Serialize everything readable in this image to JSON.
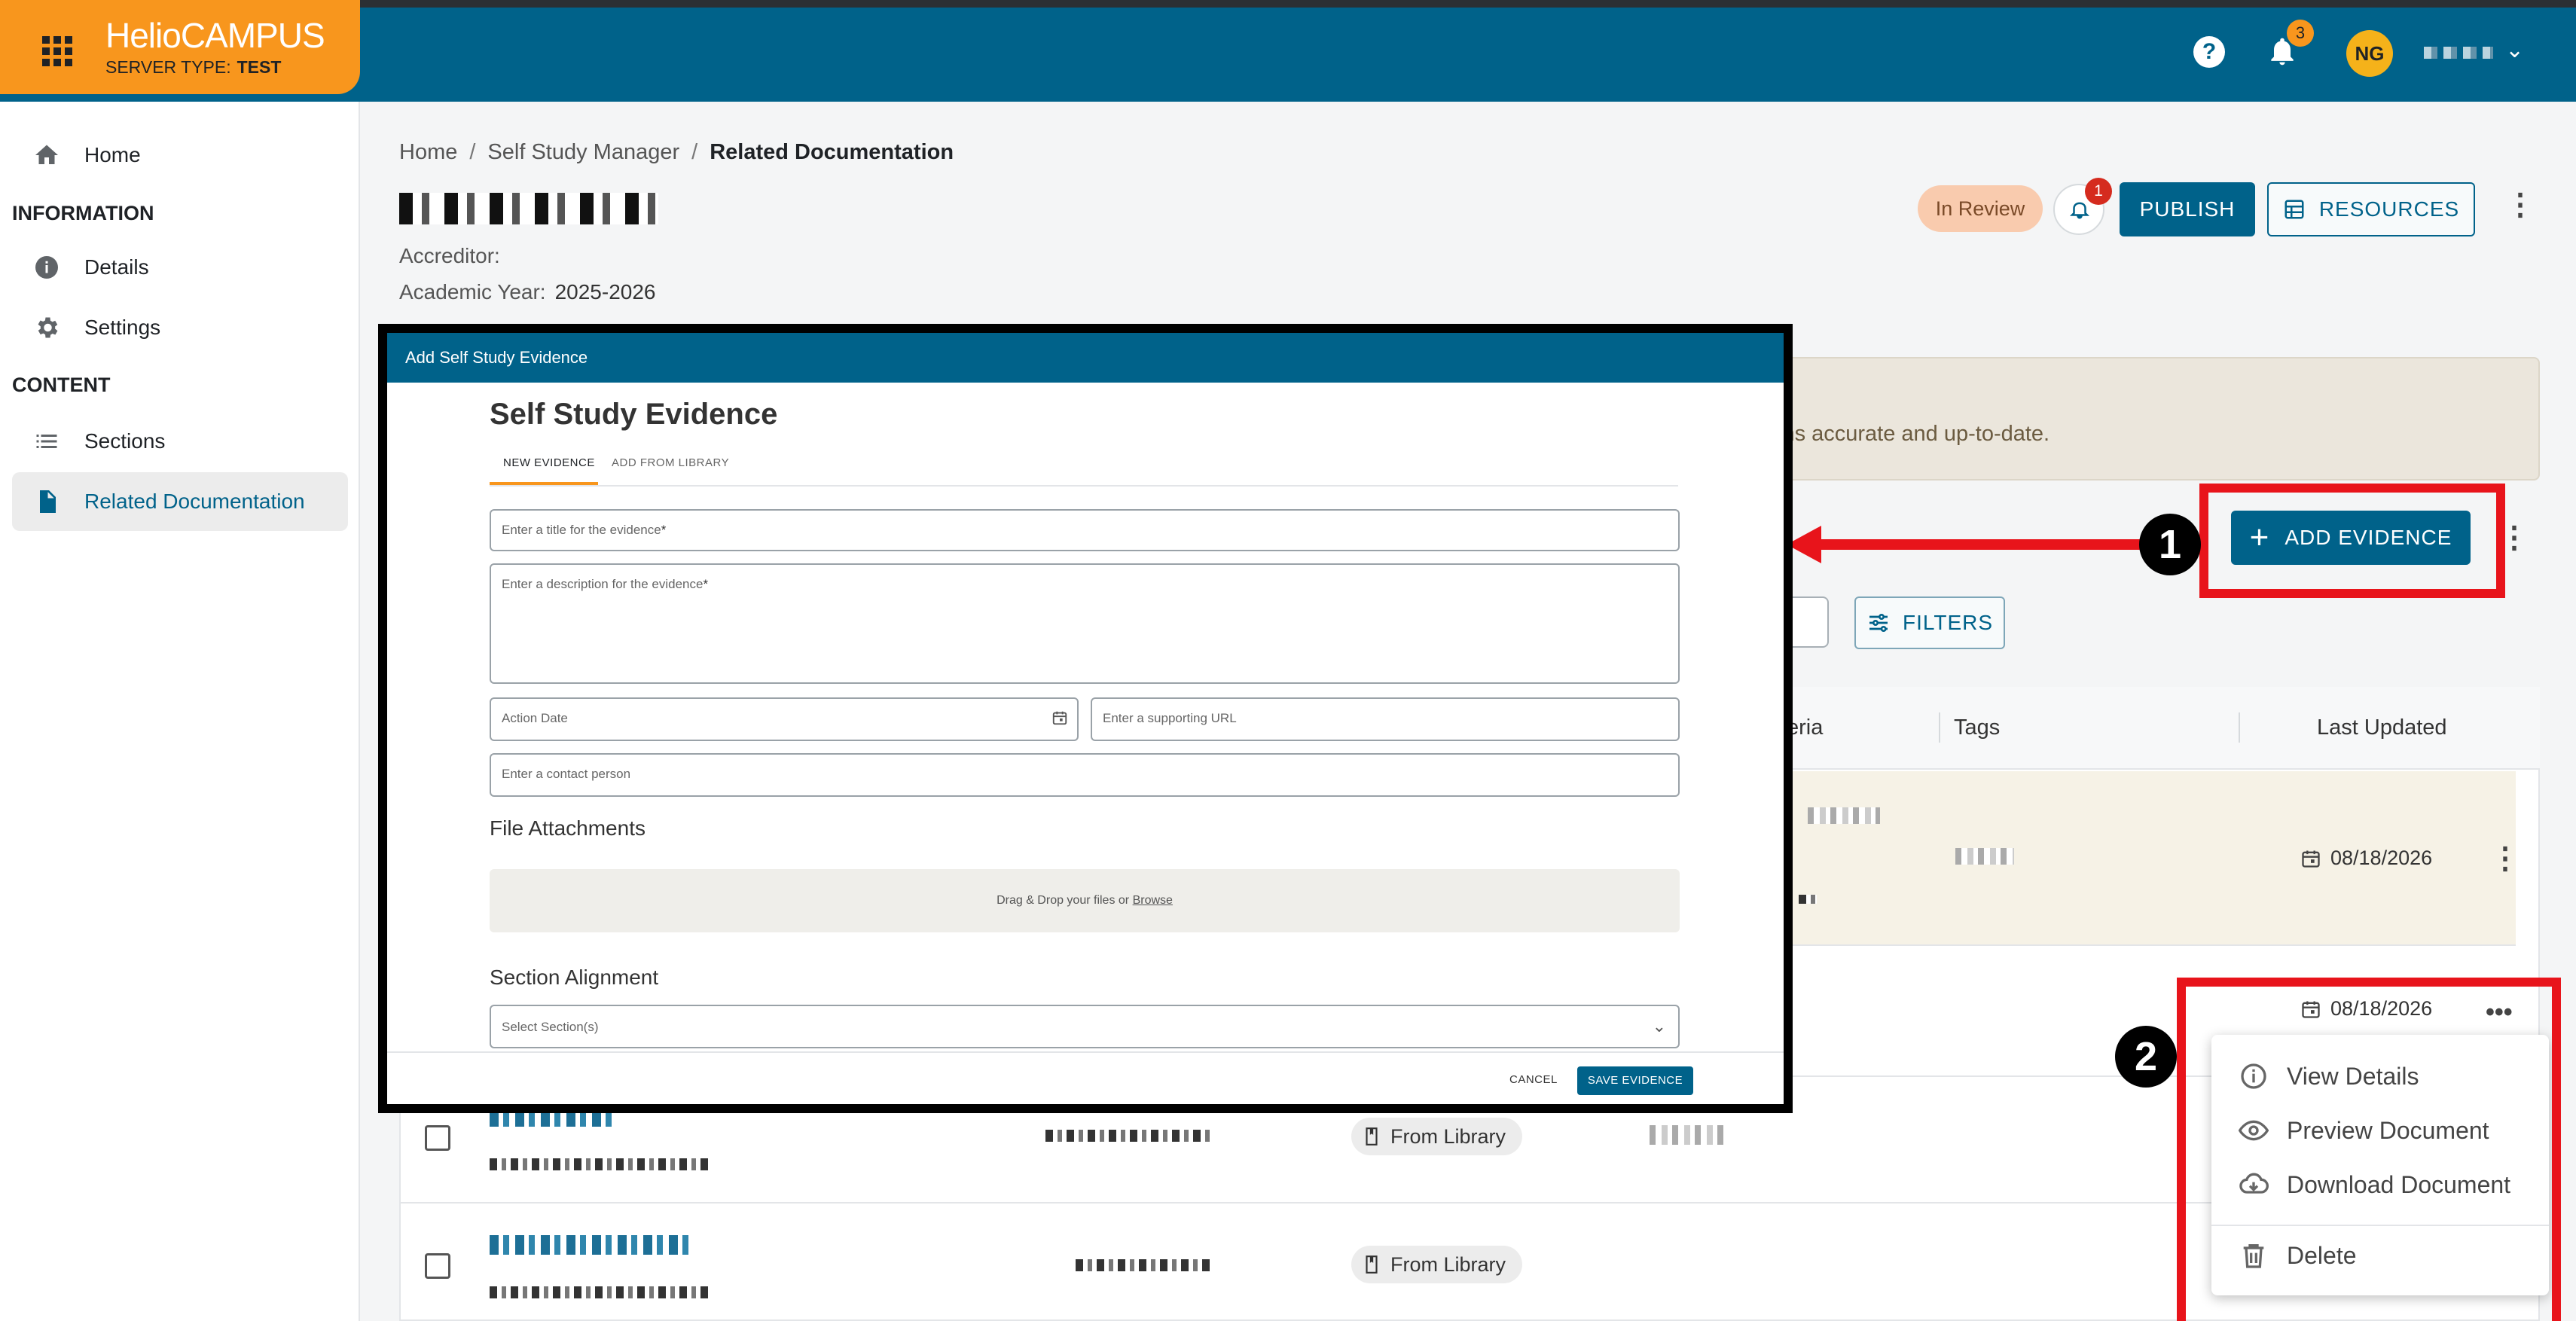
{
  "app": {
    "logo_part1": "Helio",
    "logo_part2": "CAMPUS",
    "server_label": "SERVER TYPE:",
    "server_value": "TEST",
    "notification_count": "3",
    "avatar_initials": "NG"
  },
  "sidebar": {
    "home": "Home",
    "information_heading": "INFORMATION",
    "details": "Details",
    "settings": "Settings",
    "content_heading": "CONTENT",
    "sections": "Sections",
    "related_documentation": "Related Documentation"
  },
  "breadcrumb": {
    "home": "Home",
    "self_study_manager": "Self Study Manager",
    "current": "Related Documentation",
    "separator": "/"
  },
  "header": {
    "accreditor_label": "Accreditor:",
    "academic_year_label": "Academic Year:",
    "academic_year_value": "2025-2026",
    "status": "In Review",
    "bell_count": "1",
    "publish": "PUBLISH",
    "resources": "RESOURCES"
  },
  "main": {
    "banner_text": "ins accurate and up-to-date.",
    "add_evidence": "ADD EVIDENCE",
    "filters": "FILTERS"
  },
  "table": {
    "columns": [
      "eria",
      "Tags",
      "Last Updated"
    ],
    "rows": [
      {
        "date": "08/18/2026"
      },
      {
        "date": "08/18/2026"
      },
      {
        "source": "From Library"
      },
      {
        "source": "From Library"
      }
    ]
  },
  "row_menu": {
    "view_details": "View Details",
    "preview_document": "Preview Document",
    "download_document": "Download Document",
    "delete": "Delete"
  },
  "annotations": {
    "step1": "1",
    "step2": "2"
  },
  "modal": {
    "header": "Add Self Study Evidence",
    "title": "Self Study Evidence",
    "tab_new": "NEW EVIDENCE",
    "tab_library": "ADD FROM LIBRARY",
    "title_placeholder": "Enter a title for the evidence",
    "description_placeholder": "Enter a description for the evidence",
    "required_mark": "*",
    "action_date_placeholder": "Action Date",
    "url_placeholder": "Enter a supporting URL",
    "contact_placeholder": "Enter a contact person",
    "file_attachments_label": "File Attachments",
    "dropzone_text": "Drag & Drop your files or",
    "browse_link": "Browse",
    "section_alignment_label": "Section Alignment",
    "select_placeholder": "Select Section(s)",
    "cancel": "CANCEL",
    "save": "SAVE EVIDENCE"
  },
  "colors": {
    "brand_orange": "#f8961d",
    "primary_teal": "#00628a",
    "annotation_red": "#e8141b"
  }
}
